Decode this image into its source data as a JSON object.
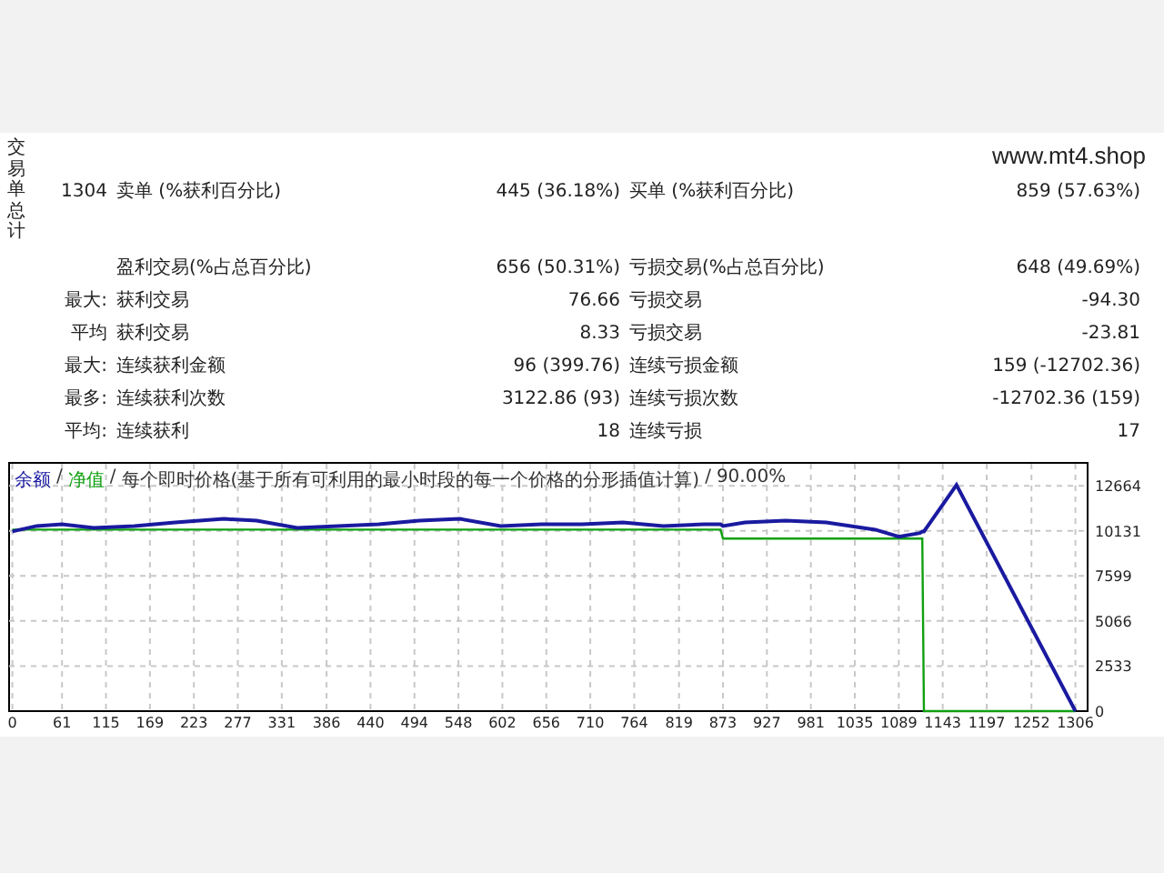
{
  "side_label": "交易单总计",
  "site": "www.mt4.shop",
  "stat_groups": [
    [
      {
        "value_1": "1304",
        "label_1": "卖单 (%获利百分比)",
        "value_2": "445 (36.18%)",
        "label_2": "买单 (%获利百分比)",
        "value_3": "859 (57.63%)"
      }
    ],
    [
      {
        "label_1": "盈利交易(%占总百分比)",
        "value_2": "656 (50.31%)",
        "label_2": "亏损交易(%占总百分比)",
        "value_3": "648 (49.69%)"
      },
      {
        "prefix": "最大:",
        "label_1": "获利交易",
        "value_2": "76.66",
        "label_2": "亏损交易",
        "value_3": "-94.30"
      },
      {
        "prefix": "平均",
        "label_1": "获利交易",
        "value_2": "8.33",
        "label_2": "亏损交易",
        "value_3": "-23.81"
      },
      {
        "prefix": "最大:",
        "label_1": "连续获利金额",
        "value_2": "96 (399.76)",
        "label_2": "连续亏损金额",
        "value_3": "159 (-12702.36)"
      },
      {
        "prefix": "最多:",
        "label_1": "连续获利次数",
        "value_2": "3122.86 (93)",
        "label_2": "连续亏损次数",
        "value_3": "-12702.36 (159)"
      },
      {
        "prefix": "平均:",
        "label_1": "连续获利",
        "value_2": "18",
        "label_2": "连续亏损",
        "value_3": "17"
      }
    ]
  ],
  "chart": {
    "header": {
      "separators": [
        "/",
        "/",
        "/"
      ],
      "mode": "每个即时价格(基于所有可利用的最小时段的每一个价格的分形插值计算)",
      "quality": "90.00%"
    },
    "chart_data": {
      "type": "line",
      "grid": true,
      "x": [
        0,
        30,
        61,
        100,
        150,
        200,
        260,
        300,
        350,
        400,
        450,
        500,
        550,
        600,
        650,
        700,
        750,
        800,
        850,
        870,
        873,
        900,
        950,
        1000,
        1060,
        1089,
        1115,
        1118,
        1120,
        1160,
        1306
      ],
      "series": [
        {
          "name": "余额",
          "color": "#1a1aa0",
          "values": [
            10100,
            10400,
            10500,
            10300,
            10400,
            10600,
            10800,
            10700,
            10300,
            10400,
            10500,
            10700,
            10800,
            10400,
            10500,
            10500,
            10600,
            10400,
            10500,
            10500,
            10400,
            10600,
            10700,
            10600,
            10200,
            9800,
            10000,
            10100,
            10100,
            12700,
            0
          ]
        },
        {
          "name": "净值",
          "color": "#10a010",
          "values": [
            10200,
            10200,
            10200,
            10200,
            10200,
            10200,
            10200,
            10200,
            10200,
            10200,
            10200,
            10200,
            10200,
            10200,
            10200,
            10200,
            10200,
            10200,
            10200,
            10200,
            9700,
            9700,
            9700,
            9700,
            9700,
            9700,
            9700,
            9700,
            0,
            0,
            0
          ]
        }
      ],
      "xlim": [
        -4,
        1321
      ],
      "ylim": [
        0,
        14000
      ],
      "xticks": [
        0,
        61,
        115,
        169,
        223,
        277,
        331,
        386,
        440,
        494,
        548,
        602,
        656,
        710,
        764,
        819,
        873,
        927,
        981,
        1035,
        1089,
        1143,
        1197,
        1252,
        1306
      ],
      "yticks": [
        0,
        2533,
        5066,
        7599,
        10131,
        12664
      ]
    }
  }
}
